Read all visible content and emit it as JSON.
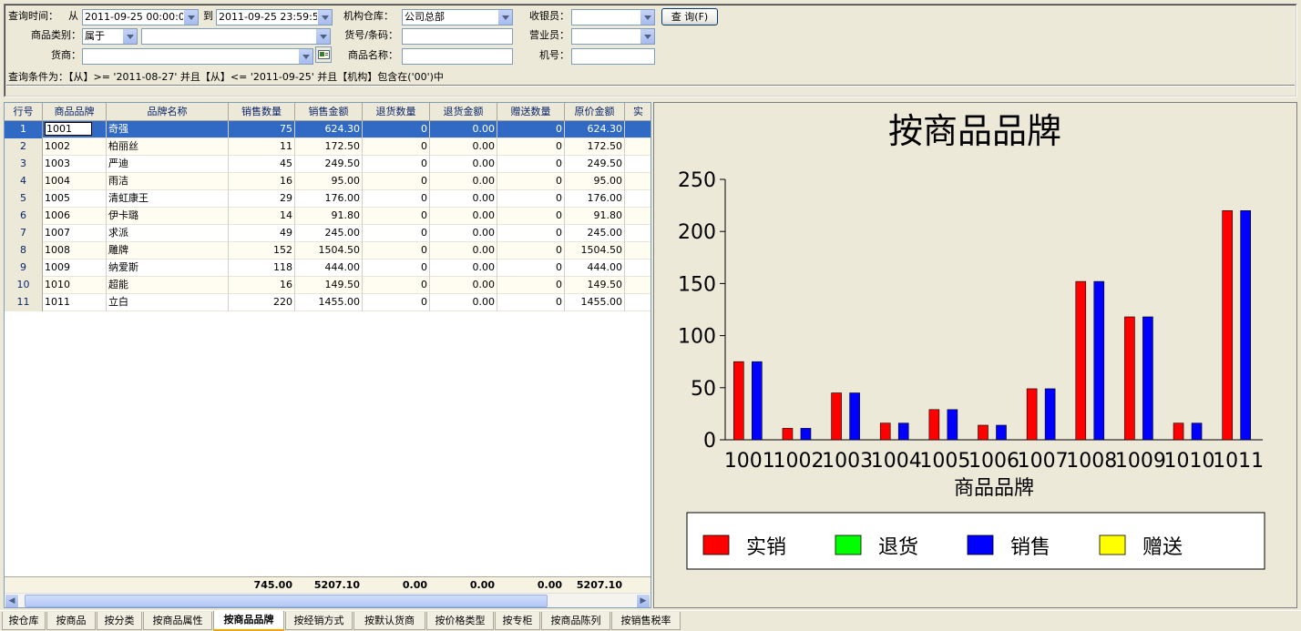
{
  "query": {
    "time_label": "查询时间：",
    "from_label": "从",
    "from_value": "2011-09-25 00:00:0",
    "to_label": "到",
    "to_value": "2011-09-25 23:59:5",
    "warehouse_label": "机构仓库：",
    "warehouse_value": "公司总部",
    "cashier_label": "收银员：",
    "cashier_value": "",
    "query_button": "查 询(F)",
    "category_label": "商品类别：",
    "category_op": "属于",
    "category_value": "",
    "barcode_label": "货号/条码：",
    "barcode_value": "",
    "salesperson_label": "营业员：",
    "salesperson_value": "",
    "supplier_label": "货商：",
    "supplier_value": "",
    "product_name_label": "商品名称：",
    "product_name_value": "",
    "machine_label": "机号：",
    "machine_value": "",
    "condition_text": "查询条件为：【从】>= '2011-08-27' 并且【从】<= '2011-09-25' 并且【机构】包含在('00')中"
  },
  "grid": {
    "headers": [
      "行号",
      "商品品牌",
      "品牌名称",
      "销售数量",
      "销售金额",
      "退货数量",
      "退货金额",
      "赠送数量",
      "原价金额",
      "实"
    ],
    "rows": [
      [
        "1",
        "1001",
        "奇强",
        "75",
        "624.30",
        "0",
        "0.00",
        "0",
        "624.30"
      ],
      [
        "2",
        "1002",
        "柏丽丝",
        "11",
        "172.50",
        "0",
        "0.00",
        "0",
        "172.50"
      ],
      [
        "3",
        "1003",
        "严迪",
        "45",
        "249.50",
        "0",
        "0.00",
        "0",
        "249.50"
      ],
      [
        "4",
        "1004",
        "雨洁",
        "16",
        "95.00",
        "0",
        "0.00",
        "0",
        "95.00"
      ],
      [
        "5",
        "1005",
        "清虹康王",
        "29",
        "176.00",
        "0",
        "0.00",
        "0",
        "176.00"
      ],
      [
        "6",
        "1006",
        "伊卡璐",
        "14",
        "91.80",
        "0",
        "0.00",
        "0",
        "91.80"
      ],
      [
        "7",
        "1007",
        "求派",
        "49",
        "245.00",
        "0",
        "0.00",
        "0",
        "245.00"
      ],
      [
        "8",
        "1008",
        "雕牌",
        "152",
        "1504.50",
        "0",
        "0.00",
        "0",
        "1504.50"
      ],
      [
        "9",
        "1009",
        "纳爱斯",
        "118",
        "444.00",
        "0",
        "0.00",
        "0",
        "444.00"
      ],
      [
        "10",
        "1010",
        "超能",
        "16",
        "149.50",
        "0",
        "0.00",
        "0",
        "149.50"
      ],
      [
        "11",
        "1011",
        "立白",
        "220",
        "1455.00",
        "0",
        "0.00",
        "0",
        "1455.00"
      ]
    ],
    "totals": [
      "",
      "",
      "",
      "745.00",
      "5207.10",
      "0.00",
      "0.00",
      "0.00",
      "5207.10"
    ]
  },
  "chart_data": {
    "type": "bar",
    "title": "按商品品牌",
    "xlabel": "商品品牌",
    "ylabel": "",
    "categories": [
      "1001",
      "1002",
      "1003",
      "1004",
      "1005",
      "1006",
      "1007",
      "1008",
      "1009",
      "1010",
      "1011"
    ],
    "ylim": [
      0,
      250
    ],
    "yticks": [
      0,
      50,
      100,
      150,
      200,
      250
    ],
    "series": [
      {
        "name": "实销",
        "color": "#FF0000",
        "values": [
          75,
          11,
          45,
          16,
          29,
          14,
          49,
          152,
          118,
          16,
          220
        ]
      },
      {
        "name": "退货",
        "color": "#00FF00",
        "values": [
          0,
          0,
          0,
          0,
          0,
          0,
          0,
          0,
          0,
          0,
          0
        ]
      },
      {
        "name": "销售",
        "color": "#0000FF",
        "values": [
          75,
          11,
          45,
          16,
          29,
          14,
          49,
          152,
          118,
          16,
          220
        ]
      },
      {
        "name": "赠送",
        "color": "#FFFF00",
        "values": [
          0,
          0,
          0,
          0,
          0,
          0,
          0,
          0,
          0,
          0,
          0
        ]
      }
    ],
    "legend": "bottom",
    "grid": false
  },
  "tabs": [
    "按仓库",
    "按商品",
    "按分类",
    "按商品属性",
    "按商品品牌",
    "按经销方式",
    "按默认货商",
    "按价格类型",
    "按专柜",
    "按商品陈列",
    "按销售税率"
  ],
  "active_tab": "按商品品牌"
}
